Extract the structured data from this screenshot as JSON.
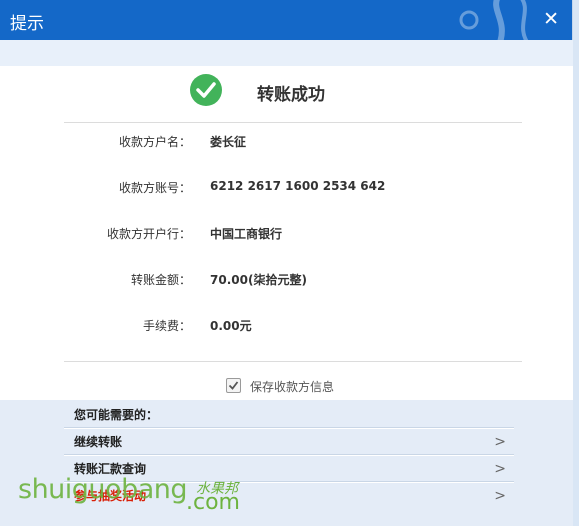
{
  "dialog": {
    "title": "提示",
    "close_symbol": "✕"
  },
  "result": {
    "icon": "check-circle-icon",
    "message": "转账成功"
  },
  "details": [
    {
      "label": "收款方户名：",
      "value": "娄长征"
    },
    {
      "label": "收款方账号：",
      "value": "6212 2617 1600 2534 642"
    },
    {
      "label": "收款方开户行：",
      "value": "中国工商银行"
    },
    {
      "label": "转账金额：",
      "value": "70.00(柒拾元整)"
    },
    {
      "label": "手续费：",
      "value": "0.00元"
    }
  ],
  "save_payee": {
    "label": "保存收款方信息",
    "checked": true
  },
  "suggestions": {
    "title": "您可能需要的：",
    "items": [
      {
        "label": "继续转账"
      },
      {
        "label": "转账汇款查询"
      },
      {
        "label": "参与抽奖活动"
      }
    ]
  },
  "watermark": {
    "text": "shuiguobang",
    "cn": "水果邦",
    "suffix": ".com"
  },
  "colors": {
    "titlebar": "#1468c8",
    "success_green": "#42b35a",
    "highlight_red": "#d81e06",
    "watermark_green": "#6db33f"
  }
}
